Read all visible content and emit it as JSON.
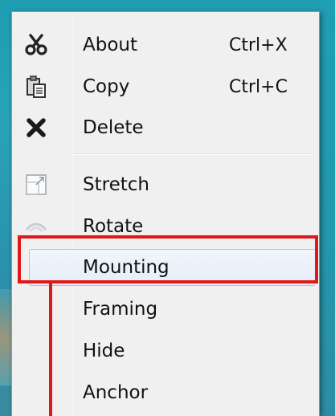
{
  "menu": {
    "items": [
      {
        "label": "About",
        "shortcut": "Ctrl+X",
        "icon": "scissors-icon",
        "enabled": true
      },
      {
        "label": "Copy",
        "shortcut": "Ctrl+C",
        "icon": "paste-icon",
        "enabled": true
      },
      {
        "label": "Delete",
        "shortcut": "",
        "icon": "delete-x-icon",
        "enabled": true
      },
      {
        "label": "Stretch",
        "shortcut": "",
        "icon": "stretch-icon",
        "enabled": true
      },
      {
        "label": "Rotate",
        "shortcut": "",
        "icon": "rotate-icon",
        "enabled": true
      },
      {
        "label": "Mounting",
        "shortcut": "",
        "icon": "",
        "enabled": true,
        "highlighted": true
      },
      {
        "label": "Framing",
        "shortcut": "",
        "icon": "",
        "enabled": true
      },
      {
        "label": "Hide",
        "shortcut": "",
        "icon": "",
        "enabled": true
      },
      {
        "label": "Anchor",
        "shortcut": "",
        "icon": "",
        "enabled": true
      }
    ]
  },
  "colors": {
    "menu_background": "#f0f0f0",
    "highlight_border": "#a8c8ea",
    "annotation": "#e01818",
    "desktop": "#2aa3b8"
  }
}
